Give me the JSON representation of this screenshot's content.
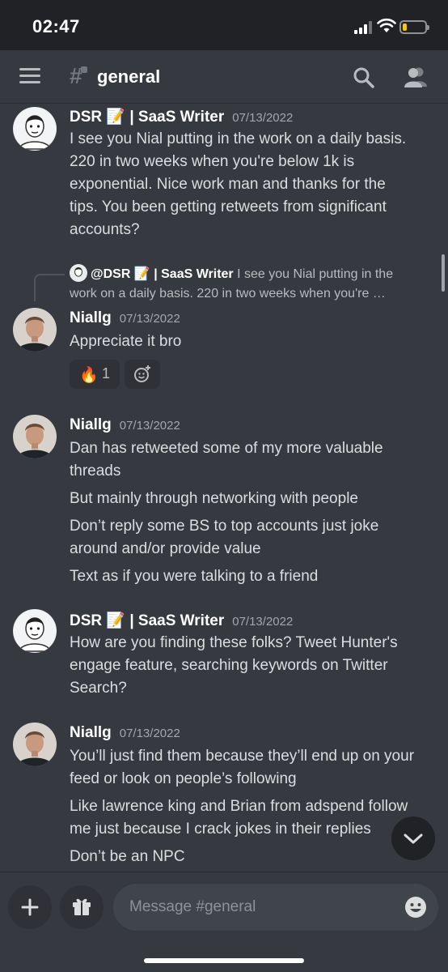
{
  "status_bar": {
    "time": "02:47",
    "battery_level": 0.2,
    "battery_color": "#f4c90f"
  },
  "header": {
    "channel_name": "general"
  },
  "colors": {
    "background": "#36393f",
    "bar": "#202225",
    "text": "#dcddde",
    "muted": "#a3a6aa"
  },
  "messages": [
    {
      "username": "DSR 📝 | SaaS Writer",
      "timestamp": "07/13/2022",
      "avatar": "dsr-avatar",
      "lines": [
        "I see you Nial putting in the work on a daily basis.",
        "220 in two weeks when you're below 1k is",
        "exponential. Nice work man and thanks for the",
        "tips. You been getting retweets from significant",
        "accounts?"
      ]
    },
    {
      "reply": {
        "name": "@DSR 📝 | SaaS Writer",
        "text_line1": "I see you Nial putting in the",
        "text_line2": "work on a daily basis. 220 in two weeks when you're …"
      },
      "username": "Niallg",
      "timestamp": "07/13/2022",
      "avatar": "niallg-avatar",
      "lines": [
        "Appreciate it bro"
      ],
      "reactions": [
        {
          "emoji": "🔥",
          "count": "1"
        }
      ]
    },
    {
      "username": "Niallg",
      "timestamp": "07/13/2022",
      "avatar": "niallg-avatar",
      "lines": [
        "Dan has retweeted some of my more valuable",
        "threads",
        "But mainly through networking with people",
        "Don’t reply some BS to top accounts just joke",
        "around and/or provide value",
        "Text as if you were talking to a friend"
      ]
    },
    {
      "username": "DSR 📝 | SaaS Writer",
      "timestamp": "07/13/2022",
      "avatar": "dsr-avatar",
      "lines": [
        "How are you finding these folks? Tweet Hunter's",
        "engage feature, searching keywords on Twitter",
        "Search?"
      ]
    },
    {
      "username": "Niallg",
      "timestamp": "07/13/2022",
      "avatar": "niallg-avatar",
      "lines": [
        "You’ll just find them because they’ll end up on your",
        "feed or look on people’s following",
        "Like lawrence king and Brian from adspend follow",
        "me just because I crack jokes in their replies",
        "Don’t be an NPC"
      ]
    }
  ],
  "composer": {
    "placeholder": "Message #general"
  }
}
